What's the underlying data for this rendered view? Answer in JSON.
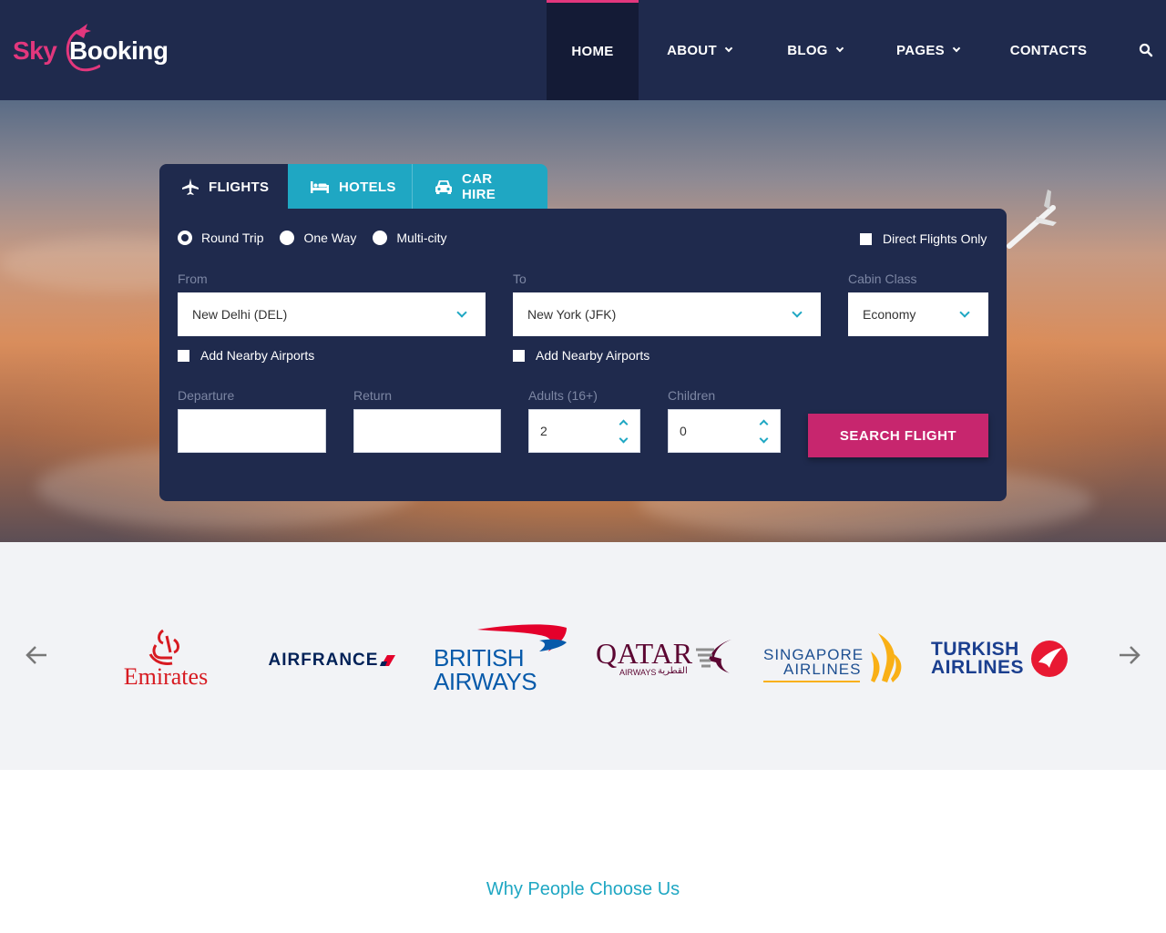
{
  "brand": {
    "part1": "Sky",
    "part2": "Booking",
    "accent": "#e2377d"
  },
  "nav": {
    "items": [
      {
        "label": "HOME",
        "active": true,
        "dropdown": false
      },
      {
        "label": "ABOUT",
        "active": false,
        "dropdown": true
      },
      {
        "label": "BLOG",
        "active": false,
        "dropdown": true
      },
      {
        "label": "PAGES",
        "active": false,
        "dropdown": true
      },
      {
        "label": "CONTACTS",
        "active": false,
        "dropdown": false
      }
    ],
    "search_icon": "search-icon"
  },
  "tabs": [
    {
      "label": "FLIGHTS",
      "icon": "plane-icon",
      "active": true
    },
    {
      "label": "HOTELS",
      "icon": "bed-icon",
      "active": false
    },
    {
      "label": "CAR HIRE",
      "icon": "car-icon",
      "active": false
    }
  ],
  "trip_type": {
    "options": [
      "Round Trip",
      "One Way",
      "Multi-city"
    ],
    "selected": "Round Trip"
  },
  "direct_flights_label": "Direct Flights Only",
  "from": {
    "label": "From",
    "value": "New Delhi (DEL)"
  },
  "to": {
    "label": "To",
    "value": "New York (JFK)"
  },
  "cabin": {
    "label": "Cabin Class",
    "value": "Economy"
  },
  "nearby_label": "Add Nearby Airports",
  "departure": {
    "label": "Departure",
    "value": ""
  },
  "return": {
    "label": "Return",
    "value": ""
  },
  "adults": {
    "label": "Adults (16+)",
    "value": "2"
  },
  "children": {
    "label": "Children",
    "value": "0"
  },
  "search_button": "SEARCH FLIGHT",
  "partners": {
    "emirates": {
      "text": "Emirates",
      "color": "#d71a21"
    },
    "airfrance": {
      "text": "AIRFRANCE",
      "color": "#002157"
    },
    "british": {
      "line1": "BRITISH",
      "line2": "AIRWAYS",
      "color": "#075aaa"
    },
    "qatar": {
      "text": "QATAR",
      "sub": "AIRWAYS",
      "sub_ar": "القطرية",
      "color": "#5c0632"
    },
    "singapore": {
      "line1": "SINGAPORE",
      "line2": "AIRLINES",
      "color": "#1d4f91",
      "accent": "#f9b016"
    },
    "turkish": {
      "line1": "TURKISH",
      "line2": "AIRLINES",
      "color": "#1b3f8f",
      "accent": "#e81932"
    }
  },
  "section_title": "Why People Choose Us",
  "colors": {
    "navy": "#1f2a4d",
    "teal": "#1fa7c3",
    "magenta": "#c7266e"
  }
}
